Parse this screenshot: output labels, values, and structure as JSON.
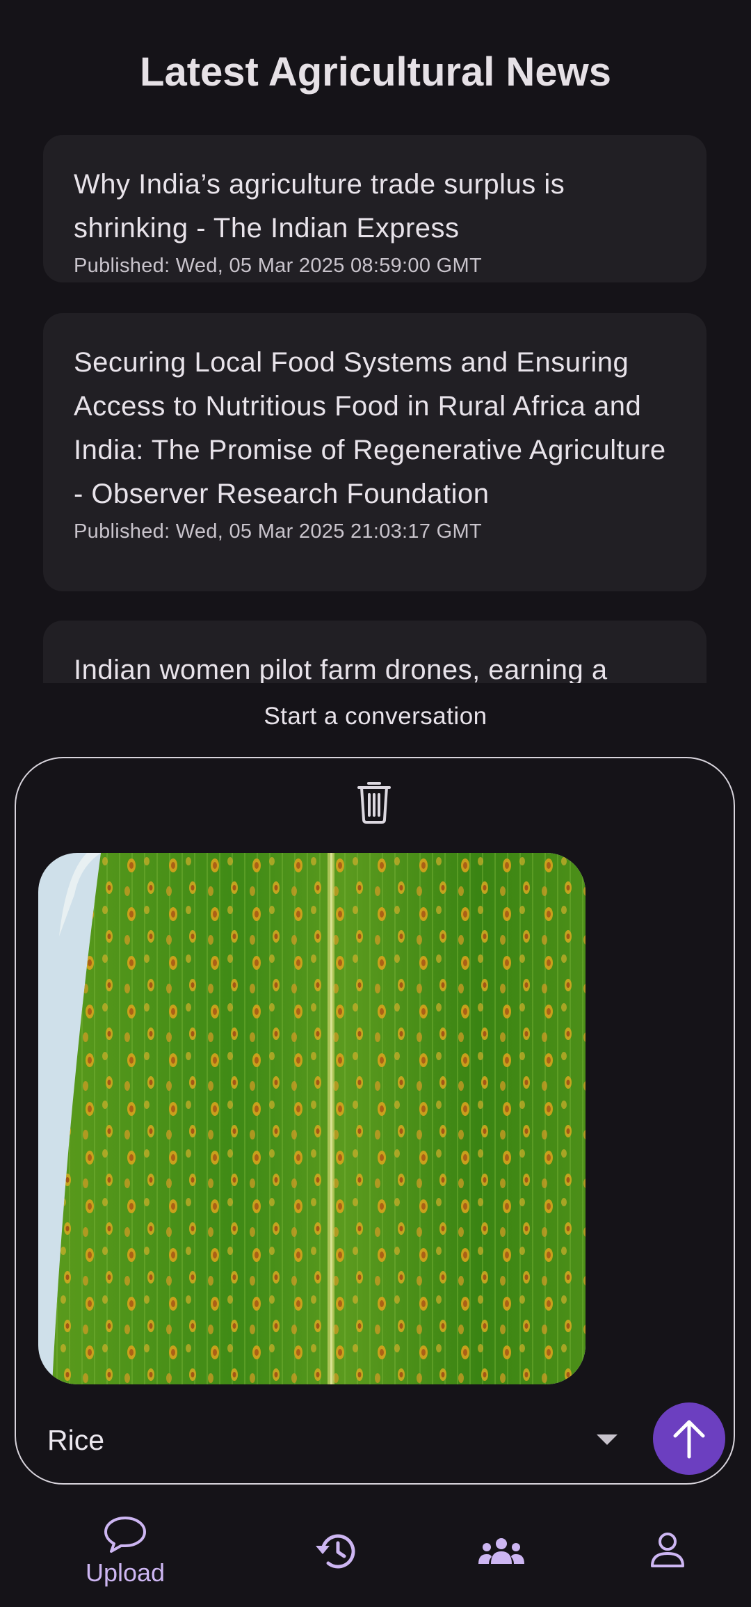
{
  "page": {
    "title": "Latest Agricultural News"
  },
  "news": [
    {
      "headline": "Why India’s agriculture trade surplus is shrinking - The Indian Express",
      "published": "Published: Wed, 05 Mar 2025 08:59:00 GMT"
    },
    {
      "headline": "Securing Local Food Systems and Ensuring Access to Nutritious Food in Rural Africa and India: The Promise of Regenerative Agriculture - Observer Research Foundation",
      "published": "Published: Wed, 05 Mar 2025 21:03:17 GMT"
    },
    {
      "headline": "Indian women pilot farm drones, earning a",
      "published": ""
    }
  ],
  "composer": {
    "prompt": "Start a conversation",
    "delete_icon": "trash-icon",
    "crop_selected": "Rice",
    "send_icon": "arrow-up-icon"
  },
  "nav": {
    "items": [
      {
        "label": "Upload",
        "icon": "chat-bubble-icon",
        "active": true
      },
      {
        "label": "",
        "icon": "history-icon",
        "active": false
      },
      {
        "label": "",
        "icon": "community-icon",
        "active": false
      },
      {
        "label": "",
        "icon": "profile-icon",
        "active": false
      }
    ]
  },
  "colors": {
    "background": "#151318",
    "card": "#211f24",
    "accent": "#6c3fc0",
    "nav_icon": "#cdb6f2"
  }
}
